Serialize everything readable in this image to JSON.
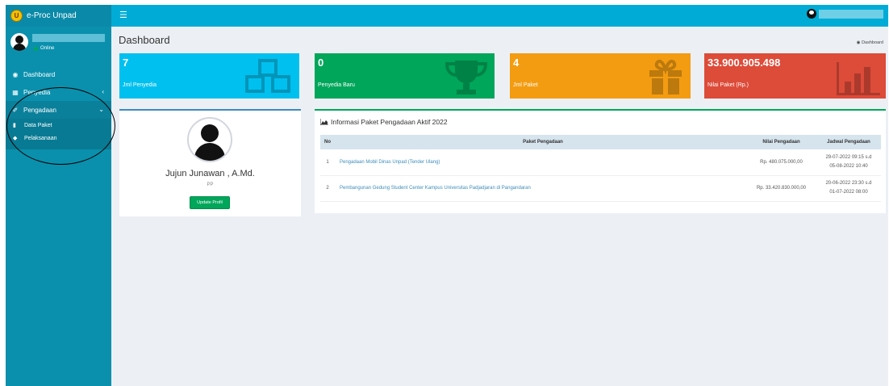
{
  "app": {
    "logo_text": "e-Proc Unpad",
    "logo_badge": "U"
  },
  "topbar": {
    "menu_icon": "hamburger-icon"
  },
  "sidebar": {
    "status": "Online",
    "items": [
      {
        "label": "Dashboard",
        "icon": "dashboard-icon"
      },
      {
        "label": "Penyedia",
        "icon": "calendar-icon"
      },
      {
        "label": "Pengadaan",
        "icon": "wrench-icon"
      }
    ],
    "subitems": [
      {
        "label": "Data Paket",
        "icon": "book-icon"
      },
      {
        "label": "Pelaksanaan",
        "icon": "tag-icon"
      }
    ]
  },
  "page": {
    "title": "Dashboard",
    "breadcrumb": "Dashboard"
  },
  "stats": [
    {
      "value": "7",
      "label": "Jml Penyedia",
      "color": "#00c0ef",
      "icon": "cubes-icon"
    },
    {
      "value": "0",
      "label": "Penyedia Baru",
      "color": "#00a65a",
      "icon": "trophy-icon"
    },
    {
      "value": "4",
      "label": "Jml Paket",
      "color": "#f39c12",
      "icon": "gift-icon"
    },
    {
      "value": "33.900.905.498",
      "label": "Nilai Paket (Rp.)",
      "color": "#dd4b39",
      "icon": "bar-chart-icon"
    }
  ],
  "profile": {
    "name": "Jujun Junawan , A.Md.",
    "role": "PP",
    "button": "Update Profil"
  },
  "info": {
    "title": "Informasi Paket Pengadaan Aktif 2022",
    "columns": [
      "No",
      "Paket Pengadaan",
      "Nilai Pengadaan",
      "Jadwal Pengadaan"
    ],
    "rows": [
      {
        "no": "1",
        "paket": "Pengadaan Mobil Dinas Unpad (Tender Ulang)",
        "nilai": "Rp. 480.075.000,00",
        "jadwal_start": "29-07-2022 09:15 s.d",
        "jadwal_end": "05-08-2022 10:40"
      },
      {
        "no": "2",
        "paket": "Pembangunan Gedung Student Center Kampus Universitas Padjadjaran di Pangandaran",
        "nilai": "Rp. 33.420.830.000,00",
        "jadwal_start": "20-06-2022 23:30 s.d",
        "jadwal_end": "01-07-2022 08:00"
      }
    ]
  }
}
